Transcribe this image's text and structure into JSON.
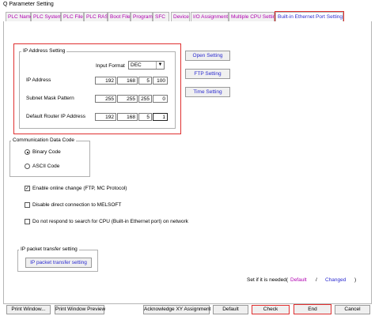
{
  "window": {
    "title": "Q Parameter Setting"
  },
  "tabs": [
    {
      "label": "PLC Name"
    },
    {
      "label": "PLC System"
    },
    {
      "label": "PLC File"
    },
    {
      "label": "PLC RAS"
    },
    {
      "label": "Boot File"
    },
    {
      "label": "Program"
    },
    {
      "label": "SFC"
    },
    {
      "label": "Device"
    },
    {
      "label": "I/O Assignment"
    },
    {
      "label": "Multiple CPU Setting"
    },
    {
      "label": "Built-in Ethernet Port Setting",
      "active": true
    }
  ],
  "ip_group": {
    "title": "IP Address Setting",
    "input_format_label": "Input Format",
    "input_format_value": "DEC",
    "ip_address_label": "IP Address",
    "ip_address": [
      "192",
      "168",
      "5",
      "100"
    ],
    "subnet_label": "Subnet Mask Pattern",
    "subnet": [
      "255",
      "255",
      "255",
      "0"
    ],
    "router_label": "Default Router IP Address",
    "router": [
      "192",
      "168",
      "5",
      "1"
    ]
  },
  "side_buttons": {
    "open_setting": "Open Setting",
    "ftp_setting": "FTP Setting",
    "time_setting": "Time Setting"
  },
  "comm_group": {
    "title": "Communication Data Code",
    "binary": "Binary Code",
    "ascii": "ASCII Code",
    "selected": "binary"
  },
  "options": {
    "online_change": "Enable online change (FTP, MC Protocol)",
    "online_change_checked": true,
    "disable_direct": "Disable direct connection to MELSOFT",
    "disable_direct_checked": false,
    "no_respond": "Do not respond to search for CPU (Built-in Ethernet port) on network",
    "no_respond_checked": false
  },
  "ip_transfer": {
    "title": "IP packet transfer setting",
    "button": "IP packet transfer setting"
  },
  "footer_note": {
    "text": "Set if it is needed(",
    "default": "Default",
    "slash": "/",
    "changed": "Changed",
    "close": ")"
  },
  "bottom_buttons": {
    "print_window": "Print Window...",
    "print_preview": "Print Window Preview",
    "acknowledge": "Acknowledge XY Assignment",
    "default": "Default",
    "check": "Check",
    "end": "End",
    "cancel": "Cancel"
  }
}
